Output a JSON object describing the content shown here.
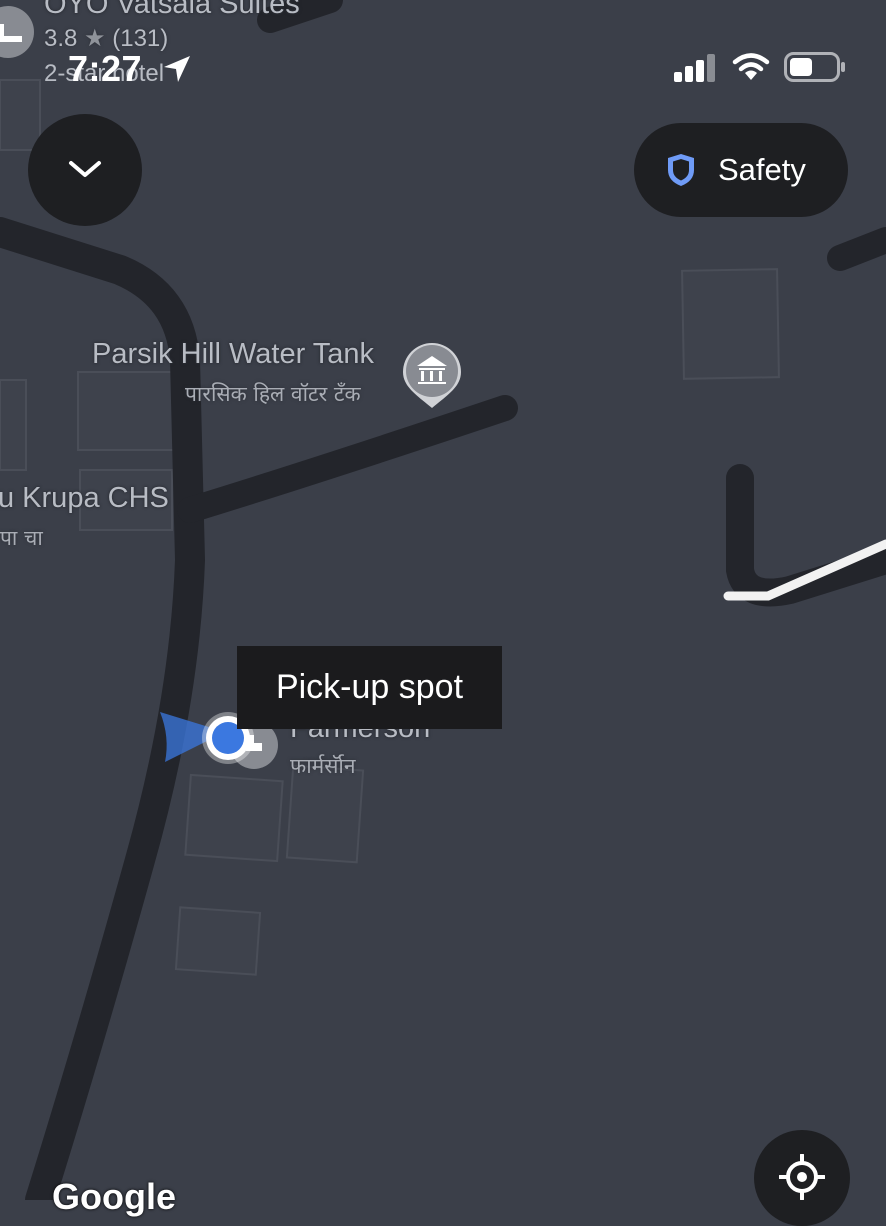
{
  "status_bar": {
    "time": "7:27",
    "icons": [
      "location-arrow-icon",
      "cellular-signal-icon",
      "wifi-icon",
      "battery-icon"
    ]
  },
  "map": {
    "pois": {
      "hotel": {
        "title": "OYO Vatsala Suites",
        "rating": "3.8",
        "reviews": "(131)",
        "category": "2-star hotel"
      },
      "water_tank": {
        "title": "Parsik Hill Water Tank",
        "subtitle": "पारसिक हिल वॉटर टँक"
      },
      "chs": {
        "title": "u Krupa CHS",
        "subtitle": "पा चा"
      },
      "farmerson": {
        "title": "Farmerson",
        "subtitle": "फार्मर्सॉन"
      }
    },
    "route_color": "#f2f2f2",
    "user_dot_color": "#3b78e0",
    "attribution": "Google"
  },
  "controls": {
    "collapse_icon": "chevron-down-icon",
    "safety_label": "Safety",
    "safety_icon": "shield-icon",
    "shield_color": "#6f9bf7",
    "recenter_icon": "crosshair-icon"
  },
  "pickup": {
    "label": "Pick-up spot"
  }
}
